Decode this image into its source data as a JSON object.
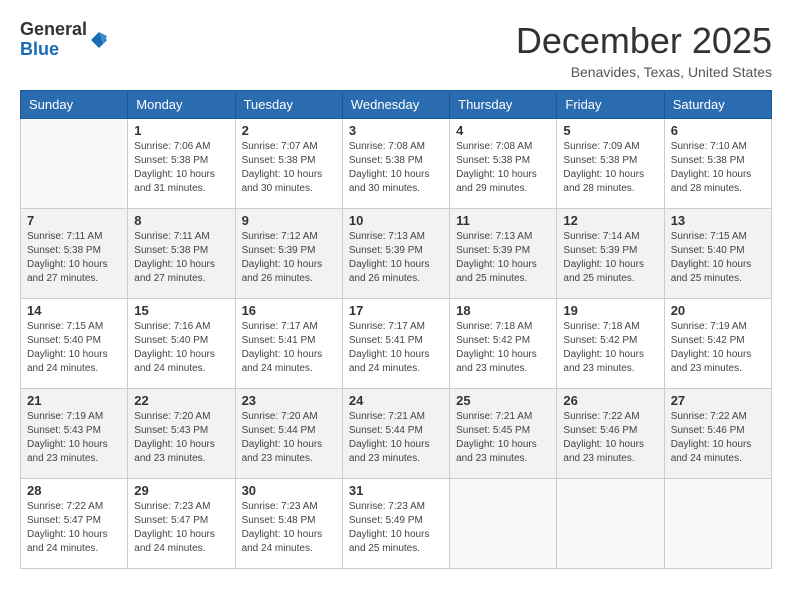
{
  "header": {
    "logo": {
      "general": "General",
      "blue": "Blue"
    },
    "title": "December 2025",
    "location": "Benavides, Texas, United States"
  },
  "calendar": {
    "weekdays": [
      "Sunday",
      "Monday",
      "Tuesday",
      "Wednesday",
      "Thursday",
      "Friday",
      "Saturday"
    ],
    "weeks": [
      [
        {
          "day": "",
          "sunrise": "",
          "sunset": "",
          "daylight": "",
          "empty": true
        },
        {
          "day": "1",
          "sunrise": "Sunrise: 7:06 AM",
          "sunset": "Sunset: 5:38 PM",
          "daylight": "Daylight: 10 hours and 31 minutes."
        },
        {
          "day": "2",
          "sunrise": "Sunrise: 7:07 AM",
          "sunset": "Sunset: 5:38 PM",
          "daylight": "Daylight: 10 hours and 30 minutes."
        },
        {
          "day": "3",
          "sunrise": "Sunrise: 7:08 AM",
          "sunset": "Sunset: 5:38 PM",
          "daylight": "Daylight: 10 hours and 30 minutes."
        },
        {
          "day": "4",
          "sunrise": "Sunrise: 7:08 AM",
          "sunset": "Sunset: 5:38 PM",
          "daylight": "Daylight: 10 hours and 29 minutes."
        },
        {
          "day": "5",
          "sunrise": "Sunrise: 7:09 AM",
          "sunset": "Sunset: 5:38 PM",
          "daylight": "Daylight: 10 hours and 28 minutes."
        },
        {
          "day": "6",
          "sunrise": "Sunrise: 7:10 AM",
          "sunset": "Sunset: 5:38 PM",
          "daylight": "Daylight: 10 hours and 28 minutes."
        }
      ],
      [
        {
          "day": "7",
          "sunrise": "Sunrise: 7:11 AM",
          "sunset": "Sunset: 5:38 PM",
          "daylight": "Daylight: 10 hours and 27 minutes."
        },
        {
          "day": "8",
          "sunrise": "Sunrise: 7:11 AM",
          "sunset": "Sunset: 5:38 PM",
          "daylight": "Daylight: 10 hours and 27 minutes."
        },
        {
          "day": "9",
          "sunrise": "Sunrise: 7:12 AM",
          "sunset": "Sunset: 5:39 PM",
          "daylight": "Daylight: 10 hours and 26 minutes."
        },
        {
          "day": "10",
          "sunrise": "Sunrise: 7:13 AM",
          "sunset": "Sunset: 5:39 PM",
          "daylight": "Daylight: 10 hours and 26 minutes."
        },
        {
          "day": "11",
          "sunrise": "Sunrise: 7:13 AM",
          "sunset": "Sunset: 5:39 PM",
          "daylight": "Daylight: 10 hours and 25 minutes."
        },
        {
          "day": "12",
          "sunrise": "Sunrise: 7:14 AM",
          "sunset": "Sunset: 5:39 PM",
          "daylight": "Daylight: 10 hours and 25 minutes."
        },
        {
          "day": "13",
          "sunrise": "Sunrise: 7:15 AM",
          "sunset": "Sunset: 5:40 PM",
          "daylight": "Daylight: 10 hours and 25 minutes."
        }
      ],
      [
        {
          "day": "14",
          "sunrise": "Sunrise: 7:15 AM",
          "sunset": "Sunset: 5:40 PM",
          "daylight": "Daylight: 10 hours and 24 minutes."
        },
        {
          "day": "15",
          "sunrise": "Sunrise: 7:16 AM",
          "sunset": "Sunset: 5:40 PM",
          "daylight": "Daylight: 10 hours and 24 minutes."
        },
        {
          "day": "16",
          "sunrise": "Sunrise: 7:17 AM",
          "sunset": "Sunset: 5:41 PM",
          "daylight": "Daylight: 10 hours and 24 minutes."
        },
        {
          "day": "17",
          "sunrise": "Sunrise: 7:17 AM",
          "sunset": "Sunset: 5:41 PM",
          "daylight": "Daylight: 10 hours and 24 minutes."
        },
        {
          "day": "18",
          "sunrise": "Sunrise: 7:18 AM",
          "sunset": "Sunset: 5:42 PM",
          "daylight": "Daylight: 10 hours and 23 minutes."
        },
        {
          "day": "19",
          "sunrise": "Sunrise: 7:18 AM",
          "sunset": "Sunset: 5:42 PM",
          "daylight": "Daylight: 10 hours and 23 minutes."
        },
        {
          "day": "20",
          "sunrise": "Sunrise: 7:19 AM",
          "sunset": "Sunset: 5:42 PM",
          "daylight": "Daylight: 10 hours and 23 minutes."
        }
      ],
      [
        {
          "day": "21",
          "sunrise": "Sunrise: 7:19 AM",
          "sunset": "Sunset: 5:43 PM",
          "daylight": "Daylight: 10 hours and 23 minutes."
        },
        {
          "day": "22",
          "sunrise": "Sunrise: 7:20 AM",
          "sunset": "Sunset: 5:43 PM",
          "daylight": "Daylight: 10 hours and 23 minutes."
        },
        {
          "day": "23",
          "sunrise": "Sunrise: 7:20 AM",
          "sunset": "Sunset: 5:44 PM",
          "daylight": "Daylight: 10 hours and 23 minutes."
        },
        {
          "day": "24",
          "sunrise": "Sunrise: 7:21 AM",
          "sunset": "Sunset: 5:44 PM",
          "daylight": "Daylight: 10 hours and 23 minutes."
        },
        {
          "day": "25",
          "sunrise": "Sunrise: 7:21 AM",
          "sunset": "Sunset: 5:45 PM",
          "daylight": "Daylight: 10 hours and 23 minutes."
        },
        {
          "day": "26",
          "sunrise": "Sunrise: 7:22 AM",
          "sunset": "Sunset: 5:46 PM",
          "daylight": "Daylight: 10 hours and 23 minutes."
        },
        {
          "day": "27",
          "sunrise": "Sunrise: 7:22 AM",
          "sunset": "Sunset: 5:46 PM",
          "daylight": "Daylight: 10 hours and 24 minutes."
        }
      ],
      [
        {
          "day": "28",
          "sunrise": "Sunrise: 7:22 AM",
          "sunset": "Sunset: 5:47 PM",
          "daylight": "Daylight: 10 hours and 24 minutes."
        },
        {
          "day": "29",
          "sunrise": "Sunrise: 7:23 AM",
          "sunset": "Sunset: 5:47 PM",
          "daylight": "Daylight: 10 hours and 24 minutes."
        },
        {
          "day": "30",
          "sunrise": "Sunrise: 7:23 AM",
          "sunset": "Sunset: 5:48 PM",
          "daylight": "Daylight: 10 hours and 24 minutes."
        },
        {
          "day": "31",
          "sunrise": "Sunrise: 7:23 AM",
          "sunset": "Sunset: 5:49 PM",
          "daylight": "Daylight: 10 hours and 25 minutes."
        },
        {
          "day": "",
          "sunrise": "",
          "sunset": "",
          "daylight": "",
          "empty": true
        },
        {
          "day": "",
          "sunrise": "",
          "sunset": "",
          "daylight": "",
          "empty": true
        },
        {
          "day": "",
          "sunrise": "",
          "sunset": "",
          "daylight": "",
          "empty": true
        }
      ]
    ]
  }
}
